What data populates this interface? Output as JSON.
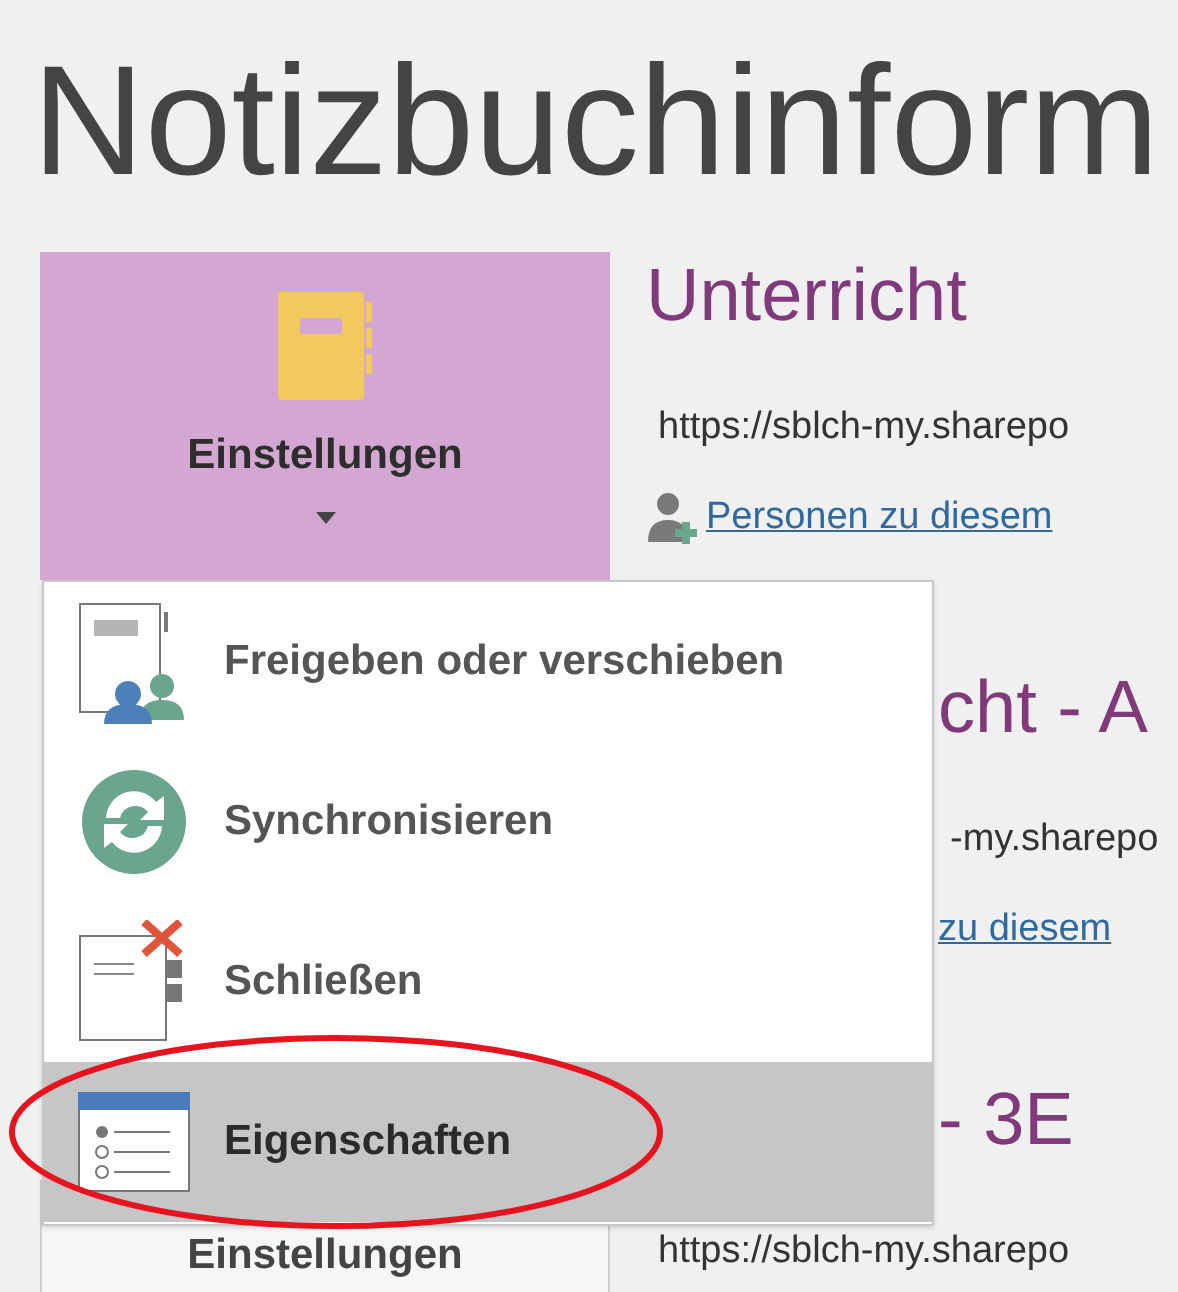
{
  "page_title": "Notizbuchinform",
  "settings_button": {
    "label": "Einstellungen"
  },
  "notebooks": [
    {
      "title": {
        "text": "Unterricht",
        "covered": false
      },
      "url": {
        "text": "https://sblch-my.sharepo",
        "covered": false
      },
      "share_link": {
        "text": "Personen zu diesem",
        "covered": false
      }
    },
    {
      "title": {
        "text": "cht - A",
        "covered": true
      },
      "url": {
        "text": "-my.sharepo",
        "covered": true
      },
      "share_link": {
        "text": "zu diesem",
        "covered": true
      }
    },
    {
      "title": {
        "text": "- 3E",
        "covered": true
      },
      "url": {
        "text": "https://sblch-my.sharepo",
        "covered": false
      }
    }
  ],
  "second_button": {
    "label": "Einstellungen"
  },
  "menu": [
    {
      "kind": "share",
      "label": "Freigeben oder verschieben",
      "selected": false
    },
    {
      "kind": "sync",
      "label": "Synchronisieren",
      "selected": false
    },
    {
      "kind": "close",
      "label": "Schließen",
      "selected": false
    },
    {
      "kind": "properties",
      "label": "Eigenschaften",
      "selected": true
    }
  ]
}
